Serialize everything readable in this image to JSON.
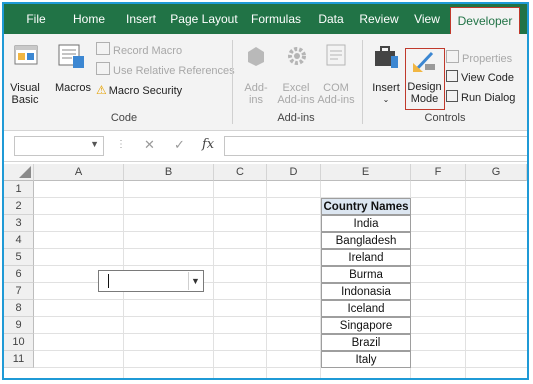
{
  "tabs": [
    "File",
    "Home",
    "Insert",
    "Page Layout",
    "Formulas",
    "Data",
    "Review",
    "View",
    "Developer"
  ],
  "active_tab": "Developer",
  "ribbon": {
    "code": {
      "visual_basic": [
        "Visual",
        "Basic"
      ],
      "macros": "Macros",
      "record_macro": "Record Macro",
      "relative_refs": "Use Relative References",
      "macro_security": "Macro Security",
      "label": "Code"
    },
    "addins": {
      "addins": [
        "Add-",
        "ins"
      ],
      "excel_addins": [
        "Excel",
        "Add-ins"
      ],
      "com_addins": [
        "COM",
        "Add-ins"
      ],
      "label": "Add-ins"
    },
    "controls": {
      "insert": "Insert",
      "design_mode": [
        "Design",
        "Mode"
      ],
      "properties": "Properties",
      "view_code": "View Code",
      "run_dialog": "Run Dialog",
      "label": "Controls"
    }
  },
  "formula_bar": {
    "name_box": "",
    "cancel_icon": "✕",
    "enter_icon": "✓",
    "fx": "fx",
    "value": ""
  },
  "columns": [
    "A",
    "B",
    "C",
    "D",
    "E",
    "F",
    "G"
  ],
  "rows": [
    "1",
    "2",
    "3",
    "4",
    "5",
    "6",
    "7",
    "8",
    "9",
    "10",
    "11"
  ],
  "table": {
    "header": "Country Names",
    "values": [
      "India",
      "Bangladesh",
      "Ireland",
      "Burma",
      "Indonasia",
      "Iceland",
      "Singapore",
      "Brazil",
      "Italy"
    ]
  },
  "combo_box": {
    "value": ""
  },
  "colors": {
    "excel_green": "#217346",
    "highlight": "#c0392b",
    "table_header": "#dce6f1"
  }
}
